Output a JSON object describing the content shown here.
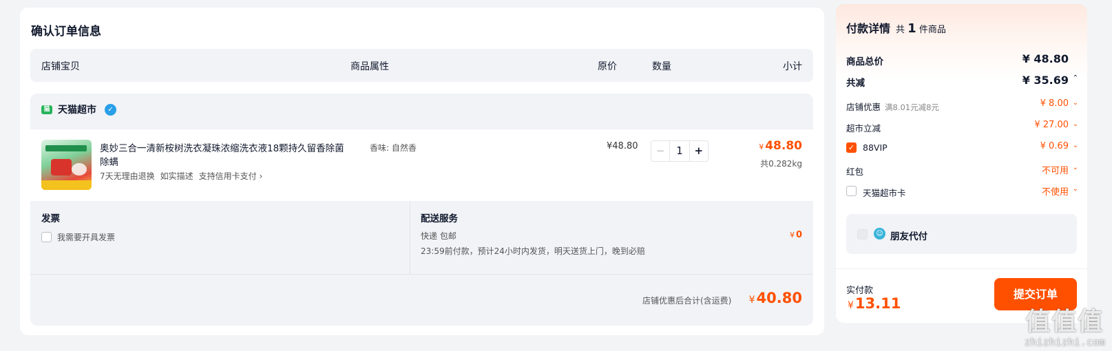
{
  "order": {
    "title": "确认订单信息",
    "columns": [
      "店铺宝贝",
      "商品属性",
      "原价",
      "数量",
      "小计"
    ],
    "shop": {
      "logo_text": "猫",
      "name": "天猫超市",
      "badge_icon": "shop-badge-icon"
    },
    "item": {
      "title": "奥妙三合一清新桉树洗衣凝珠浓缩洗衣液18颗持久留香除菌除螨",
      "tags": [
        "7天无理由退换",
        "如实描述",
        "支持信用卡支付 ›"
      ],
      "attribute": "香味: 自然香",
      "price": "¥48.80",
      "quantity": "1",
      "minus": "−",
      "plus": "+",
      "subtotal_symbol": "¥",
      "subtotal": "48.80",
      "weight": "共0.282kg"
    },
    "invoice": {
      "title": "发票",
      "checkbox_label": "我需要开具发票"
    },
    "delivery": {
      "title": "配送服务",
      "method": "快递 包邮",
      "detail": "23:59前付款，预计24小时内发货，明天送货上门，晚到必赔",
      "fee_symbol": "¥",
      "fee": "0"
    },
    "shop_total": {
      "label": "店铺优惠后合计(含运费)",
      "symbol": "¥",
      "amount": "40.80"
    }
  },
  "payment": {
    "title": "付款详情",
    "count_prefix": "共",
    "count": "1",
    "count_suffix": "件商品",
    "goods_total_label": "商品总价",
    "goods_total": "¥ 48.80",
    "discount_label": "共减",
    "discount_total": "¥ 35.69",
    "discount_chevron": "⌃",
    "shop_promo_label": "店铺优惠",
    "shop_promo_hint": "满8.01元减8元",
    "shop_promo_value": "¥ 8.00",
    "market_label": "超市立减",
    "market_value": "¥ 27.00",
    "vip_label": "88VIP",
    "vip_value": "¥ 0.69",
    "redpack_label": "红包",
    "redpack_value": "不可用",
    "card_label": "天猫超市卡",
    "card_value": "不使用",
    "chevron": "⌄",
    "friend_pay_label": "朋友代付",
    "actual_label": "实付款",
    "actual_symbol": "¥",
    "actual_amount": "13.11",
    "submit_label": "提交订单"
  },
  "watermark": {
    "chars": "值值值",
    "domain": "zhizhizhi.com"
  },
  "colors": {
    "accent": "#ff5000",
    "panel": "#f1f3f6",
    "page_bg": "#f3f4f6"
  }
}
